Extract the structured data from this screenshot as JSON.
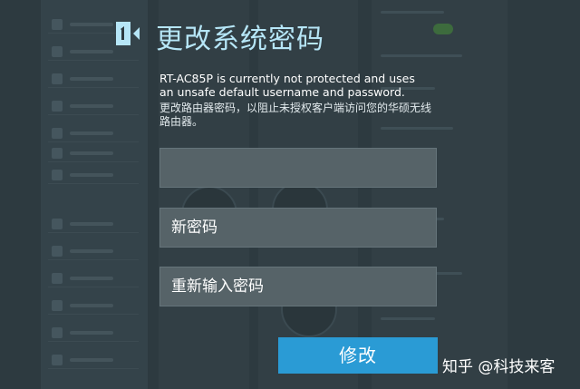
{
  "dialog": {
    "title": "更改系统密码",
    "warning_en": "RT-AC85P is currently not protected and uses an unsafe default username and password.",
    "warning_cn": "更改路由器密码，以阻止未授权客户端访问您的华硕无线路由器。",
    "fields": [
      {
        "value": "",
        "placeholder": ""
      },
      {
        "value": "新密码"
      },
      {
        "value": "重新输入密码"
      }
    ],
    "submit_label": "修改"
  },
  "watermark": "知乎 @科技来客",
  "colors": {
    "title": "#b6e6f7",
    "submit_bg": "#2a9bd5",
    "field_bg": "#566368",
    "overlay_bg": "#2d3a40"
  },
  "icons": {
    "logo": "router-setup-icon"
  }
}
